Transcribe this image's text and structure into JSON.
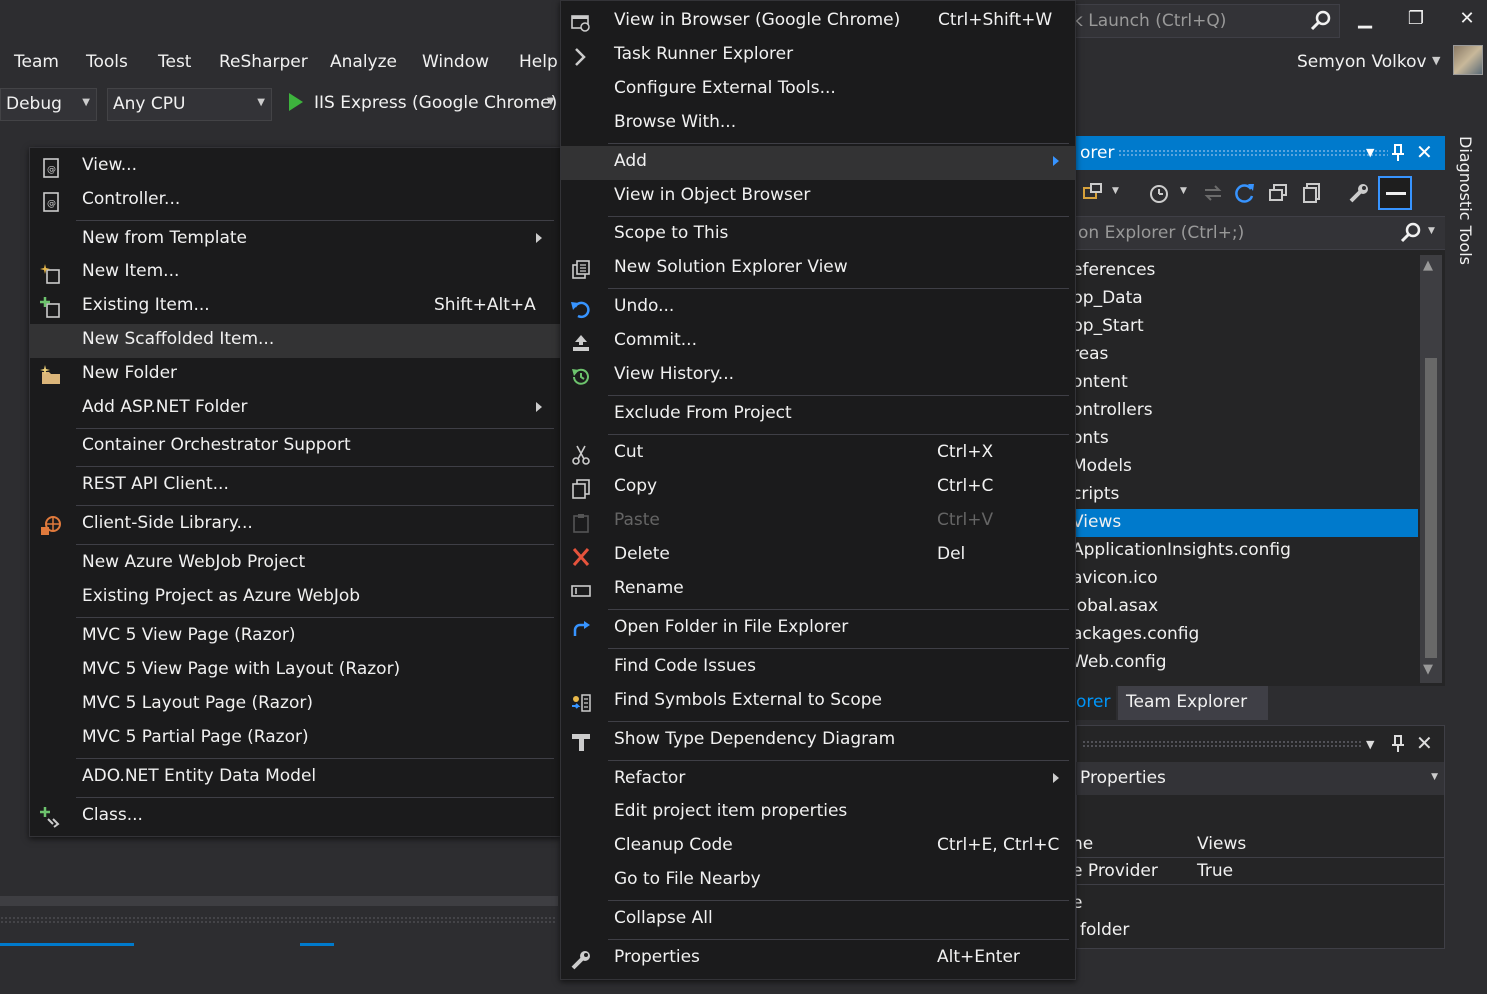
{
  "quick_launch": {
    "placeholder": "k Launch (Ctrl+Q)"
  },
  "window_buttons": {
    "minimize": "▁",
    "maximize": "❐",
    "close": "✕"
  },
  "menubar": [
    "Team",
    "Tools",
    "Test",
    "ReSharper",
    "Analyze",
    "Window",
    "Help"
  ],
  "user": {
    "name": "Semyon Volkov"
  },
  "toolbar": {
    "config": "Debug",
    "platform": "Any CPU",
    "run_target": "IIS Express (Google Chrome)"
  },
  "add_menu": {
    "items": [
      {
        "label": "View...",
        "icon": "view-icon"
      },
      {
        "label": "Controller...",
        "icon": "controller-icon"
      },
      {
        "label": "New from Template",
        "submenu": true
      },
      {
        "label": "New Item...",
        "icon": "new-item-icon"
      },
      {
        "label": "Existing Item...",
        "icon": "existing-item-icon",
        "shortcut": "Shift+Alt+A"
      },
      {
        "label": "New Scaffolded Item...",
        "highlighted": true
      },
      {
        "label": "New Folder",
        "icon": "new-folder-icon"
      },
      {
        "label": "Add ASP.NET Folder",
        "submenu": true
      },
      {
        "label": "Container Orchestrator Support"
      },
      {
        "label": "REST API Client..."
      },
      {
        "label": "Client-Side Library...",
        "icon": "client-library-icon"
      },
      {
        "label": "New Azure WebJob Project"
      },
      {
        "label": "Existing Project as Azure WebJob"
      },
      {
        "label": "MVC 5 View Page (Razor)"
      },
      {
        "label": "MVC 5 View Page with Layout (Razor)"
      },
      {
        "label": "MVC 5 Layout Page (Razor)"
      },
      {
        "label": "MVC 5 Partial Page (Razor)"
      },
      {
        "label": "ADO.NET Entity Data Model"
      },
      {
        "label": "Class...",
        "icon": "class-icon"
      }
    ]
  },
  "context_menu": {
    "items": [
      {
        "label": "View in Browser (Google Chrome)",
        "shortcut": "Ctrl+Shift+W",
        "icon": "browser-icon"
      },
      {
        "label": "Task Runner Explorer",
        "icon": "chevron-right-icon"
      },
      {
        "label": "Configure External Tools..."
      },
      {
        "label": "Browse With..."
      },
      {
        "label": "Add",
        "submenu": true,
        "highlighted": true
      },
      {
        "label": "View in Object Browser"
      },
      {
        "label": "Scope to This"
      },
      {
        "label": "New Solution Explorer View",
        "icon": "solution-view-icon"
      },
      {
        "label": "Undo...",
        "icon": "undo-icon"
      },
      {
        "label": "Commit...",
        "icon": "commit-icon"
      },
      {
        "label": "View History...",
        "icon": "history-icon"
      },
      {
        "label": "Exclude From Project"
      },
      {
        "label": "Cut",
        "shortcut": "Ctrl+X",
        "icon": "scissors-icon"
      },
      {
        "label": "Copy",
        "shortcut": "Ctrl+C",
        "icon": "copy-icon"
      },
      {
        "label": "Paste",
        "shortcut": "Ctrl+V",
        "icon": "paste-icon",
        "disabled": true
      },
      {
        "label": "Delete",
        "shortcut": "Del",
        "icon": "delete-icon"
      },
      {
        "label": "Rename",
        "icon": "rename-icon"
      },
      {
        "label": "Open Folder in File Explorer",
        "icon": "open-folder-icon"
      },
      {
        "label": "Find Code Issues"
      },
      {
        "label": "Find Symbols External to Scope",
        "icon": "find-symbols-icon"
      },
      {
        "label": "Show Type Dependency Diagram",
        "icon": "diagram-icon"
      },
      {
        "label": "Refactor",
        "submenu": true
      },
      {
        "label": "Edit project item properties"
      },
      {
        "label": "Cleanup Code",
        "shortcut": "Ctrl+E, Ctrl+C"
      },
      {
        "label": "Go to File Nearby"
      },
      {
        "label": "Collapse All"
      },
      {
        "label": "Properties",
        "shortcut": "Alt+Enter",
        "icon": "wrench-icon"
      }
    ]
  },
  "solution_explorer": {
    "title": "orer",
    "search_placeholder": "on Explorer (Ctrl+;)",
    "tree": [
      {
        "label": "eferences"
      },
      {
        "label": "pp_Data"
      },
      {
        "label": "pp_Start"
      },
      {
        "label": "reas"
      },
      {
        "label": "ontent"
      },
      {
        "label": "ontrollers"
      },
      {
        "label": "onts"
      },
      {
        "label": "Models"
      },
      {
        "label": "cripts"
      },
      {
        "label": "Views",
        "selected": true
      },
      {
        "label": "ApplicationInsights.config"
      },
      {
        "label": "avicon.ico"
      },
      {
        "label": "lobal.asax"
      },
      {
        "label": "ackages.config"
      },
      {
        "label": "Web.config"
      }
    ],
    "tabs": {
      "active": "orer",
      "other": "Team Explorer"
    }
  },
  "properties": {
    "header": "Properties",
    "rows": [
      {
        "key": "ne",
        "value": "Views"
      },
      {
        "key": "e Provider",
        "value": "True"
      }
    ],
    "desc_line1": "e",
    "desc_line2": "folder"
  },
  "diagnostic_tools": "Diagnostic Tools",
  "colors": {
    "accent": "#007acc",
    "menu_bg": "#1b1b1c",
    "highlight": "#333334",
    "bg": "#2d2d30"
  }
}
